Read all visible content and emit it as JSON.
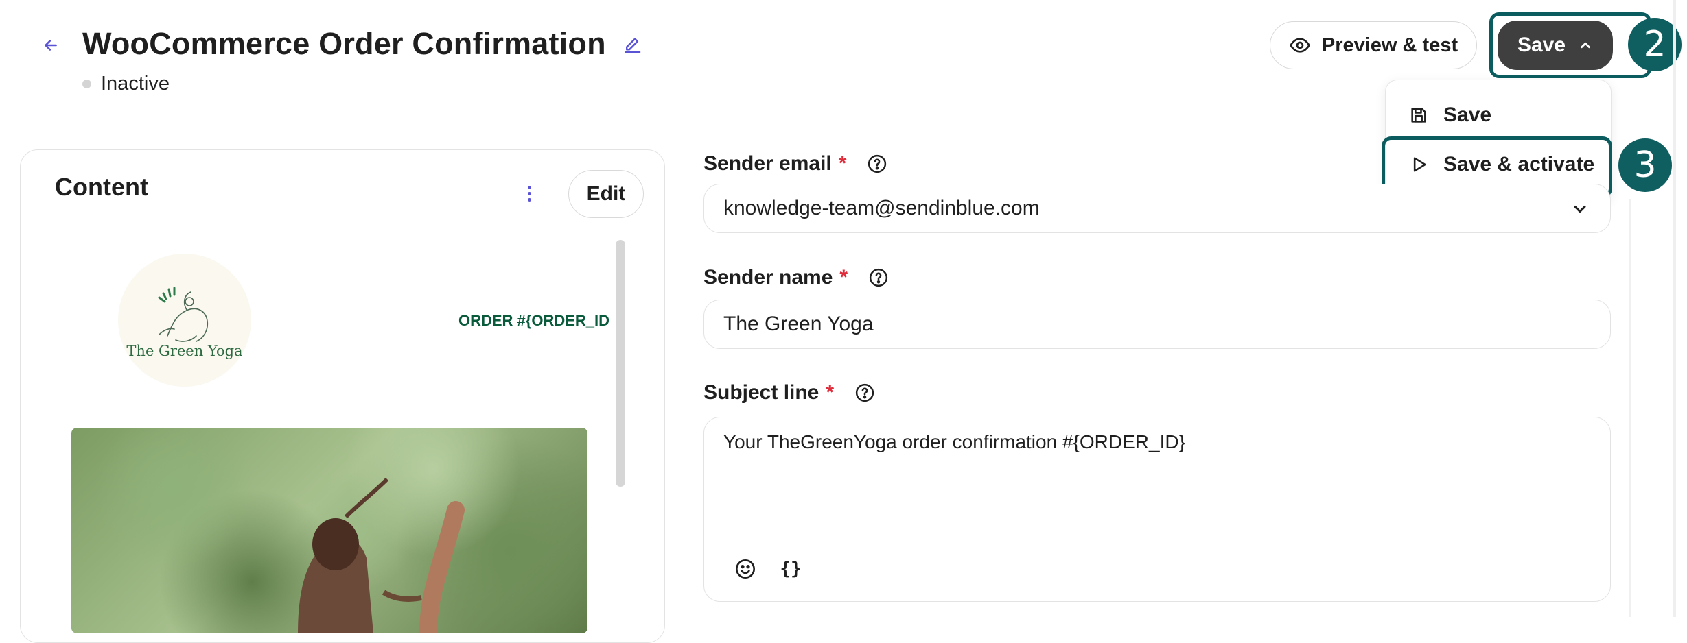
{
  "header": {
    "title": "WooCommerce Order Confirmation",
    "status": "Inactive",
    "preview_label": "Preview & test",
    "save_label": "Save"
  },
  "save_menu": {
    "items": [
      {
        "label": "Save",
        "icon": "floppy-disk-icon"
      },
      {
        "label": "Save & activate",
        "icon": "play-icon"
      }
    ]
  },
  "markers": {
    "save_button": "2",
    "save_activate": "3"
  },
  "content_card": {
    "title": "Content",
    "edit_label": "Edit",
    "logo_text": "The Green Yoga",
    "order_text": "ORDER #{ORDER_ID"
  },
  "form": {
    "sender_email": {
      "label": "Sender email",
      "required_mark": "*",
      "value": "knowledge-team@sendinblue.com"
    },
    "sender_name": {
      "label": "Sender name",
      "required_mark": "*",
      "value": "The Green Yoga"
    },
    "subject_line": {
      "label": "Subject line",
      "required_mark": "*",
      "value": "Your TheGreenYoga order confirmation #{ORDER_ID}",
      "tools": {
        "emoji": "emoji-icon",
        "variable": "{}"
      }
    }
  },
  "colors": {
    "accent": "#5b53d6",
    "highlight": "#0b5c5f",
    "required": "#e02d3c",
    "save_button": "#3f3f3f"
  }
}
